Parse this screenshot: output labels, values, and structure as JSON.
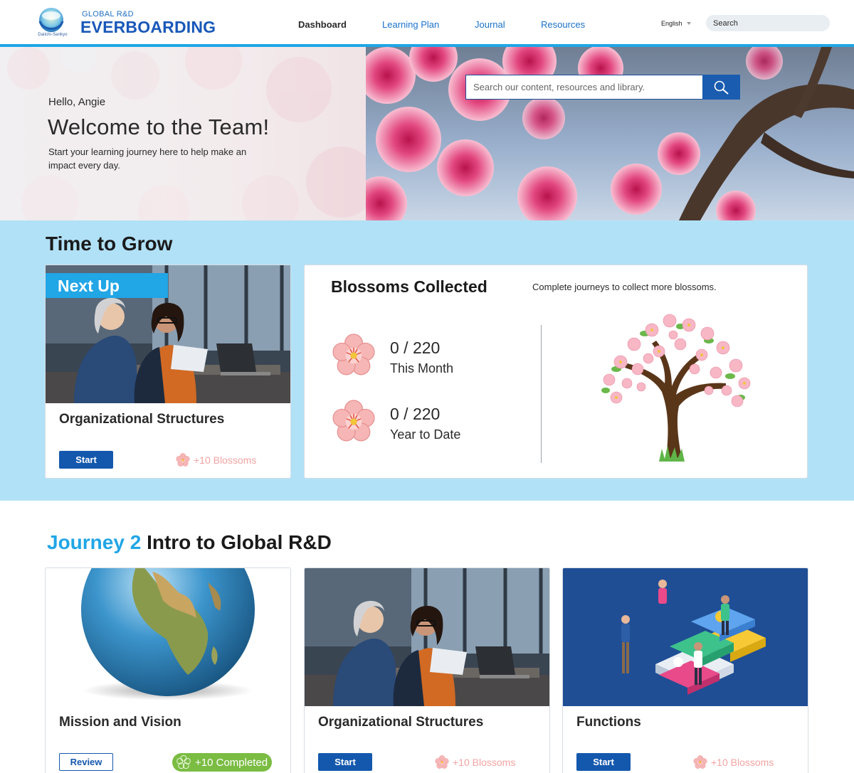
{
  "header": {
    "brand_small": "Daiichi-Sankyo",
    "subtitle": "GLOBAL R&D",
    "title": "EVERBOARDING",
    "nav": [
      "Dashboard",
      "Learning Plan",
      "Journal",
      "Resources"
    ],
    "active_nav": "Dashboard",
    "language": "English",
    "search_placeholder": "Search",
    "accent_color": "#1ea6e6"
  },
  "hero": {
    "greeting": "Hello, Angie",
    "title": "Welcome to the Team!",
    "text": "Start your learning journey here to help make an impact every day.",
    "search_placeholder": "Search our content, resources and library."
  },
  "grow": {
    "title": "Time to Grow",
    "next_up": {
      "tag": "Next Up",
      "course": "Organizational Structures",
      "button": "Start",
      "reward": "+10 Blossoms"
    },
    "blossoms": {
      "title": "Blossoms Collected",
      "subtitle": "Complete journeys to collect more blossoms.",
      "stats": [
        {
          "value": "0 / 220",
          "label": "This Month"
        },
        {
          "value": "0 / 220",
          "label": "Year to Date"
        }
      ]
    }
  },
  "journey": {
    "number": "Journey 2",
    "title": "Intro to Global R&D",
    "cards": [
      {
        "title": "Mission and Vision",
        "button": "Review",
        "status": "+10 Completed"
      },
      {
        "title": "Organizational Structures",
        "button": "Start",
        "reward": "+10 Blossoms"
      },
      {
        "title": "Functions",
        "button": "Start",
        "reward": "+10 Blossoms"
      }
    ]
  }
}
